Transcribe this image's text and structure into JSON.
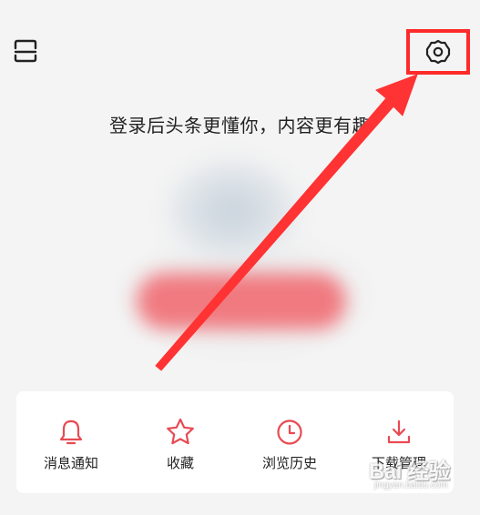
{
  "header": {
    "scan_icon": "scan-icon",
    "settings_icon": "gear-icon"
  },
  "login": {
    "prompt": "登录后头条更懂你，内容更有趣"
  },
  "menu": {
    "items": [
      {
        "label": "消息通知",
        "icon": "bell-icon"
      },
      {
        "label": "收藏",
        "icon": "star-icon"
      },
      {
        "label": "浏览历史",
        "icon": "clock-icon"
      },
      {
        "label": "下载管理",
        "icon": "download-icon"
      }
    ]
  },
  "annotation": {
    "highlight_color": "#ff2a2a",
    "arrow_color": "#ff3333"
  },
  "watermark": {
    "brand": "Bai 经验",
    "sub": "jingyan.baidu.com"
  },
  "colors": {
    "accent": "#e84a53",
    "background": "#f4f4f4",
    "card": "#ffffff"
  }
}
